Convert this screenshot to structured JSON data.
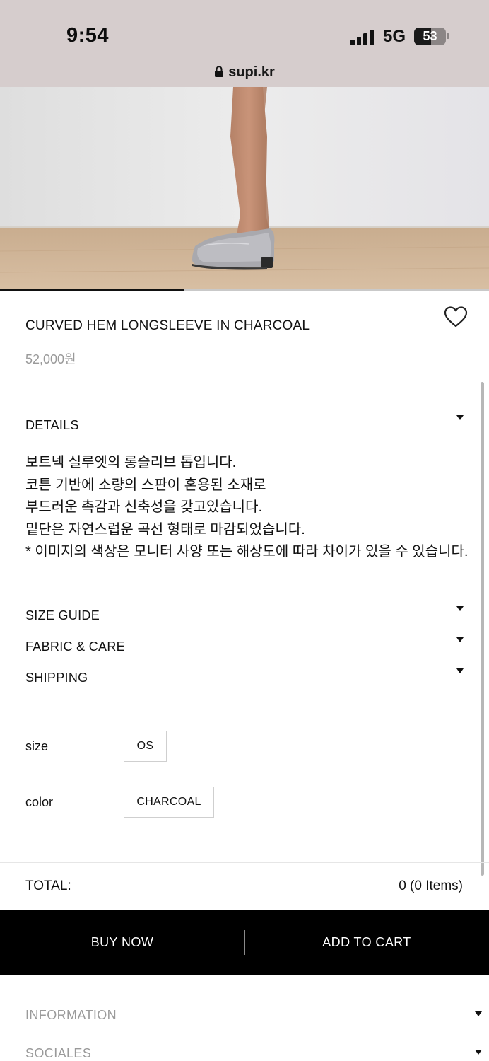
{
  "status_bar": {
    "time": "9:54",
    "network": "5G",
    "battery_level": "53",
    "battery_fraction": 0.53,
    "signal_bars": 4
  },
  "url_bar": {
    "domain": "supi.kr",
    "icon": "lock-icon"
  },
  "gallery": {
    "slide_progress_fraction": 0.375
  },
  "product": {
    "title": "CURVED HEM LONGSLEEVE IN CHARCOAL",
    "price": "52,000원",
    "wishlist_icon": "heart-outline-icon"
  },
  "accordions": {
    "details": {
      "label": "DETAILS",
      "lines": [
        "보트넥 실루엣의 롱슬리브 톱입니다.",
        "코튼 기반에 소량의 스판이 혼용된 소재로",
        "부드러운 촉감과 신축성을 갖고있습니다.",
        "밑단은 자연스럽운 곡선 형태로 마감되었습니다.",
        "* 이미지의 색상은 모니터 사양 또는 해상도에 따라 차이가 있을 수 있습니다."
      ]
    },
    "size_guide": {
      "label": "SIZE GUIDE"
    },
    "fabric_care": {
      "label": "FABRIC & CARE"
    },
    "shipping": {
      "label": "SHIPPING"
    }
  },
  "options": {
    "size": {
      "label": "size",
      "value": "OS"
    },
    "color": {
      "label": "color",
      "value": "CHARCOAL"
    }
  },
  "total": {
    "label": "TOTAL:",
    "value": "0 (0 Items)"
  },
  "actions": {
    "buy_now": "BUY NOW",
    "add_to_cart": "ADD TO CART"
  },
  "footer": {
    "information": "INFORMATION",
    "sociales": "SOCIALES"
  },
  "colors": {
    "status_bar_bg": "#d6cdcd",
    "action_bar_bg": "#000000",
    "muted_text": "#9a9a9a"
  }
}
